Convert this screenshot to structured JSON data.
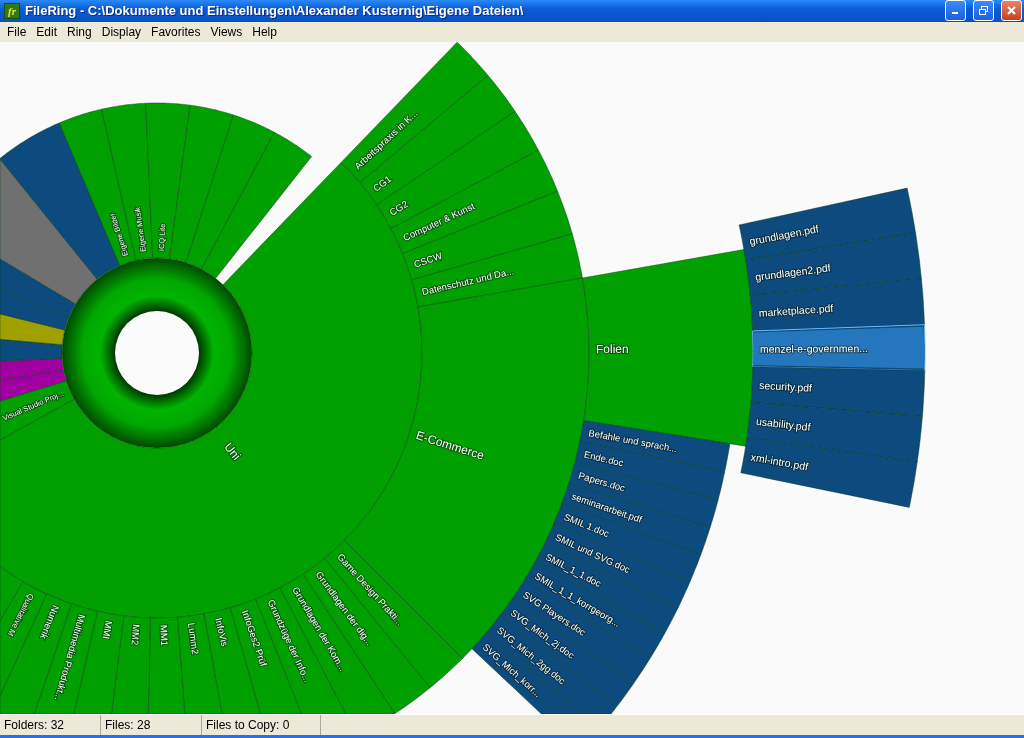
{
  "window": {
    "icon_text": "fr",
    "title": "FileRing - C:\\Dokumente und Einstellungen\\Alexander Kusternig\\Eigene Dateien\\"
  },
  "menu": [
    {
      "label": "File"
    },
    {
      "label": "Edit"
    },
    {
      "label": "Ring"
    },
    {
      "label": "Display"
    },
    {
      "label": "Favorites"
    },
    {
      "label": "Views"
    },
    {
      "label": "Help"
    }
  ],
  "ring": {
    "children": [
      {
        "label": "Uni",
        "color": "#00a000",
        "children": [
          {
            "label": "Arbeitspraxis in K...",
            "color": "#00a000"
          },
          {
            "label": "CG1",
            "color": "#00a000"
          },
          {
            "label": "CG2",
            "color": "#00a000"
          },
          {
            "label": "Computer & Kunst",
            "color": "#00a000"
          },
          {
            "label": "CSCW",
            "color": "#00a000"
          },
          {
            "label": "Datenschutz und Da...",
            "color": "#00a000"
          },
          {
            "label": "E-Commerce",
            "color": "#00a000",
            "children": [
              {
                "label": "Folien",
                "color": "#00a000",
                "children": [
                  {
                    "label": "grundlagen.pdf",
                    "color": "#0d4a7e",
                    "selected": false
                  },
                  {
                    "label": "grundlagen2.pdf",
                    "color": "#0d4a7e",
                    "selected": false
                  },
                  {
                    "label": "marketplace.pdf",
                    "color": "#0d4a7e",
                    "selected": false
                  },
                  {
                    "label": "menzel-e-governmen...",
                    "color": "#0d4a7e",
                    "selected": true
                  },
                  {
                    "label": "security.pdf",
                    "color": "#0d4a7e",
                    "selected": false
                  },
                  {
                    "label": "usability.pdf",
                    "color": "#0d4a7e",
                    "selected": false
                  },
                  {
                    "label": "xml-intro.pdf",
                    "color": "#0d4a7e",
                    "selected": false
                  }
                ]
              },
              {
                "label": "Befahle und sprach...",
                "color": "#0d4a7e"
              },
              {
                "label": "Ende.doc",
                "color": "#0d4a7e"
              },
              {
                "label": "Papers.doc",
                "color": "#0d4a7e"
              },
              {
                "label": "seminararbeit.pdf",
                "color": "#0d4a7e"
              },
              {
                "label": "SMIL 1.doc",
                "color": "#0d4a7e"
              },
              {
                "label": "SMIL und SVG.doc",
                "color": "#0d4a7e"
              },
              {
                "label": "SMIL_1_1.doc",
                "color": "#0d4a7e"
              },
              {
                "label": "SMIL_1_1_korrgeorg...",
                "color": "#0d4a7e"
              },
              {
                "label": "SVG Players.doc",
                "color": "#0d4a7e"
              },
              {
                "label": "SVG_Mich_2j.doc",
                "color": "#0d4a7e"
              },
              {
                "label": "SVG_Mich_2gg.doc",
                "color": "#0d4a7e"
              },
              {
                "label": "SVG_Mich_korr...",
                "color": "#0d4a7e"
              }
            ]
          },
          {
            "label": "Game Design Prakti...",
            "color": "#00a000"
          },
          {
            "label": "Grundlagen der dig...",
            "color": "#00a000"
          },
          {
            "label": "Grundlagen der Kom...",
            "color": "#00a000"
          },
          {
            "label": "Grundzüge der Info...",
            "color": "#00a000"
          },
          {
            "label": "InfoGes2 Prüf",
            "color": "#00a000"
          },
          {
            "label": "InfoVis",
            "color": "#00a000"
          },
          {
            "label": "Lumm2",
            "color": "#00a000"
          },
          {
            "label": "MM1",
            "color": "#00a000"
          },
          {
            "label": "MM2",
            "color": "#00a000"
          },
          {
            "label": "MMI",
            "color": "#00a000"
          },
          {
            "label": "Multimedia Produkt...",
            "color": "#00a000"
          },
          {
            "label": "Numerik",
            "color": "#00a000"
          },
          {
            "label": "Qualitative M",
            "color": "#00a000"
          },
          {
            "color": "#00a000"
          }
        ]
      },
      {
        "label": "Visual Studio Proj...",
        "color": "#00a000"
      },
      {
        "color": "#a000a0"
      },
      {
        "color": "#a000a0"
      },
      {
        "color": "#0d4a7e"
      },
      {
        "color": "#a0a000"
      },
      {
        "color": "#0d4a7e"
      },
      {
        "color": "#0d4a7e"
      },
      {
        "color": "#707070"
      },
      {
        "color": "#0d4a7e"
      },
      {
        "label": "Eigene Bilder",
        "color": "#00a000"
      },
      {
        "label": "Eigene Musik",
        "color": "#00a000"
      },
      {
        "label": "ICQ Lite",
        "color": "#00a000"
      },
      {
        "color": "#00a000"
      },
      {
        "color": "#00a000"
      },
      {
        "color": "#00a000"
      }
    ]
  },
  "status_bar": [
    "Folders: 32",
    "Files: 28",
    "Files to Copy: 0"
  ]
}
